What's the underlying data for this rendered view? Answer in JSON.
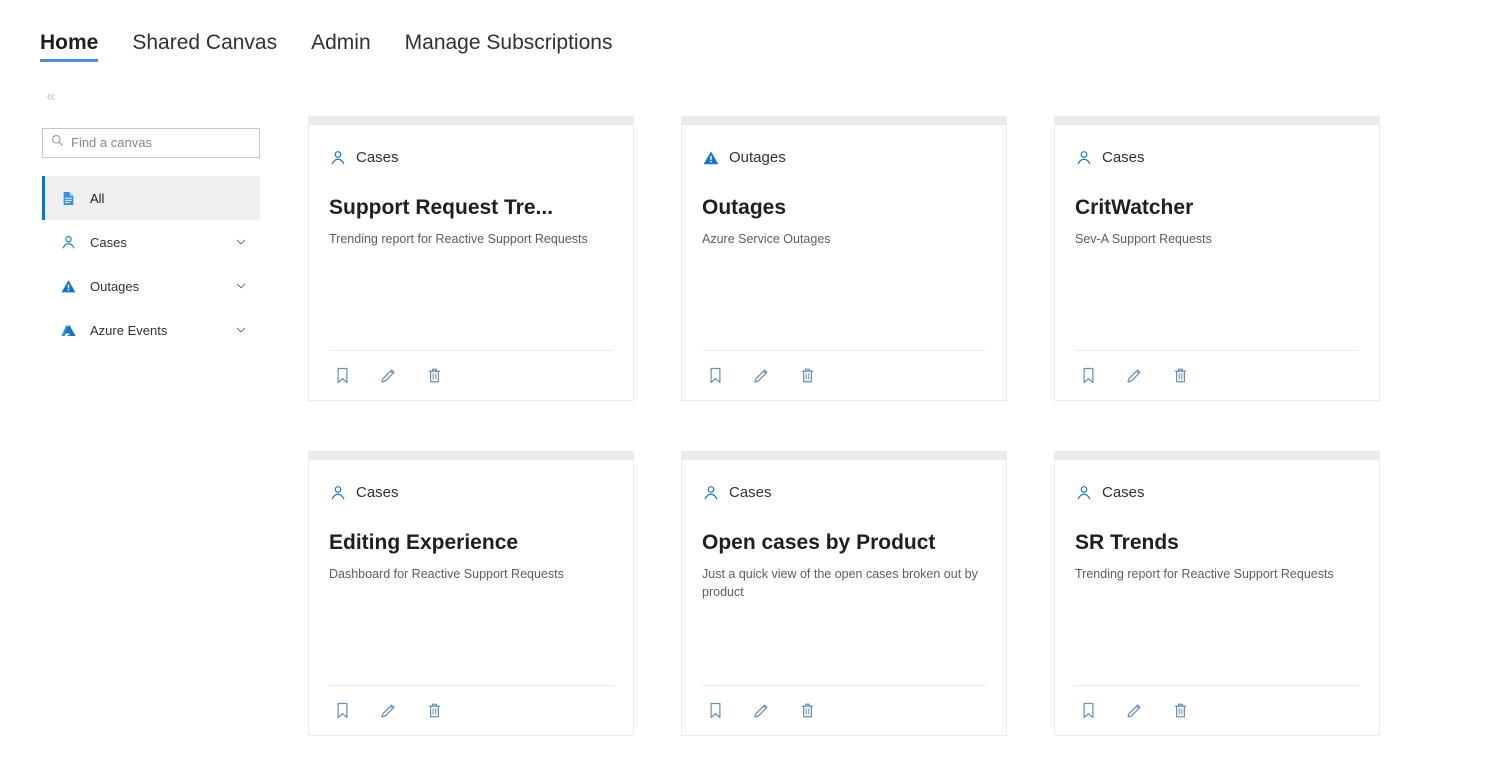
{
  "topnav": {
    "items": [
      {
        "label": "Home",
        "active": true
      },
      {
        "label": "Shared Canvas",
        "active": false
      },
      {
        "label": "Admin",
        "active": false
      },
      {
        "label": "Manage Subscriptions",
        "active": false
      }
    ]
  },
  "collapse": {
    "icon": "double-chevron-left-icon",
    "glyph": "«"
  },
  "sidebar": {
    "search": {
      "placeholder": "Find a canvas",
      "value": "",
      "icon": "search-icon"
    },
    "items": [
      {
        "label": "All",
        "icon": "page-icon",
        "selected": true,
        "expandable": false
      },
      {
        "label": "Cases",
        "icon": "person-icon",
        "selected": false,
        "expandable": true
      },
      {
        "label": "Outages",
        "icon": "warning-triangle-icon",
        "selected": false,
        "expandable": true
      },
      {
        "label": "Azure Events",
        "icon": "azure-logo-icon",
        "selected": false,
        "expandable": true
      }
    ]
  },
  "colors": {
    "accent": "#0078d4",
    "nav_underline": "#4f8ecc",
    "card_border": "#ebebeb",
    "card_strip": "#ebebeb",
    "selected_row_bg": "#efefef",
    "title_text": "#201f1e",
    "muted_text": "#605e5c",
    "footer_icon": "#6b8fb5"
  },
  "cards": [
    {
      "category": "Cases",
      "category_icon": "person-icon",
      "title": "Support Request Tre...",
      "description": "Trending report for Reactive Support Requests",
      "actions": [
        {
          "name": "bookmark-icon",
          "label": "Bookmark"
        },
        {
          "name": "pencil-icon",
          "label": "Edit"
        },
        {
          "name": "trash-icon",
          "label": "Delete"
        }
      ]
    },
    {
      "category": "Outages",
      "category_icon": "warning-triangle-icon",
      "title": "Outages",
      "description": "Azure Service Outages",
      "actions": [
        {
          "name": "bookmark-icon",
          "label": "Bookmark"
        },
        {
          "name": "pencil-icon",
          "label": "Edit"
        },
        {
          "name": "trash-icon",
          "label": "Delete"
        }
      ]
    },
    {
      "category": "Cases",
      "category_icon": "person-icon",
      "title": "CritWatcher",
      "description": "Sev-A Support Requests",
      "actions": [
        {
          "name": "bookmark-icon",
          "label": "Bookmark"
        },
        {
          "name": "pencil-icon",
          "label": "Edit"
        },
        {
          "name": "trash-icon",
          "label": "Delete"
        }
      ]
    },
    {
      "category": "Cases",
      "category_icon": "person-icon",
      "title": "Editing Experience",
      "description": "Dashboard for Reactive Support Requests",
      "actions": [
        {
          "name": "bookmark-icon",
          "label": "Bookmark"
        },
        {
          "name": "pencil-icon",
          "label": "Edit"
        },
        {
          "name": "trash-icon",
          "label": "Delete"
        }
      ]
    },
    {
      "category": "Cases",
      "category_icon": "person-icon",
      "title": "Open cases by Product",
      "description": "Just a quick view of the open cases broken out by product",
      "actions": [
        {
          "name": "bookmark-icon",
          "label": "Bookmark"
        },
        {
          "name": "pencil-icon",
          "label": "Edit"
        },
        {
          "name": "trash-icon",
          "label": "Delete"
        }
      ]
    },
    {
      "category": "Cases",
      "category_icon": "person-icon",
      "title": "SR Trends",
      "description": "Trending report for Reactive Support Requests",
      "actions": [
        {
          "name": "bookmark-icon",
          "label": "Bookmark"
        },
        {
          "name": "pencil-icon",
          "label": "Edit"
        },
        {
          "name": "trash-icon",
          "label": "Delete"
        }
      ]
    }
  ]
}
